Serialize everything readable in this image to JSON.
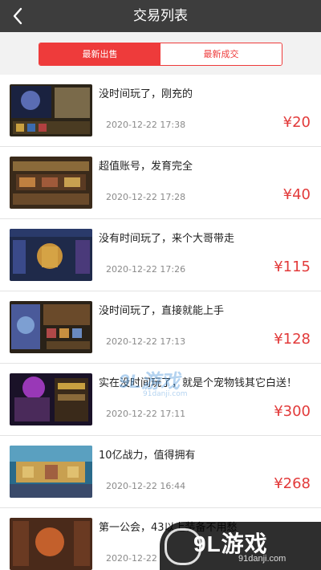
{
  "header": {
    "title": "交易列表",
    "back_icon": "chevron-left-icon"
  },
  "tabs": [
    {
      "label": "最新出售",
      "active": true
    },
    {
      "label": "最新成交",
      "active": false
    }
  ],
  "items": [
    {
      "title": "没时间玩了，刚充的",
      "date": "2020-12-22 17:38",
      "price": "¥20"
    },
    {
      "title": "超值账号，发育完全",
      "date": "2020-12-22 17:28",
      "price": "¥40"
    },
    {
      "title": "没有时间玩了，来个大哥带走",
      "date": "2020-12-22 17:26",
      "price": "¥115"
    },
    {
      "title": "没时间玩了，直接就能上手",
      "date": "2020-12-22 17:13",
      "price": "¥128"
    },
    {
      "title": "实在没时间玩了，就是个宠物钱其它白送！",
      "date": "2020-12-22 17:11",
      "price": "¥300"
    },
    {
      "title": "10亿战力，值得拥有",
      "date": "2020-12-22 16:44",
      "price": "¥268"
    },
    {
      "title": "第一公会，43以上装备不用愁",
      "date": "2020-12-22",
      "price": ""
    }
  ],
  "watermark": {
    "center_text": "9L游戏",
    "center_sub": "91danji.com",
    "logo_text": "9L游戏",
    "logo_sub": "91danji.com"
  },
  "colors": {
    "accent": "#ee3b3b",
    "price": "#e23a3a",
    "header_bg": "#3d3d3d"
  }
}
